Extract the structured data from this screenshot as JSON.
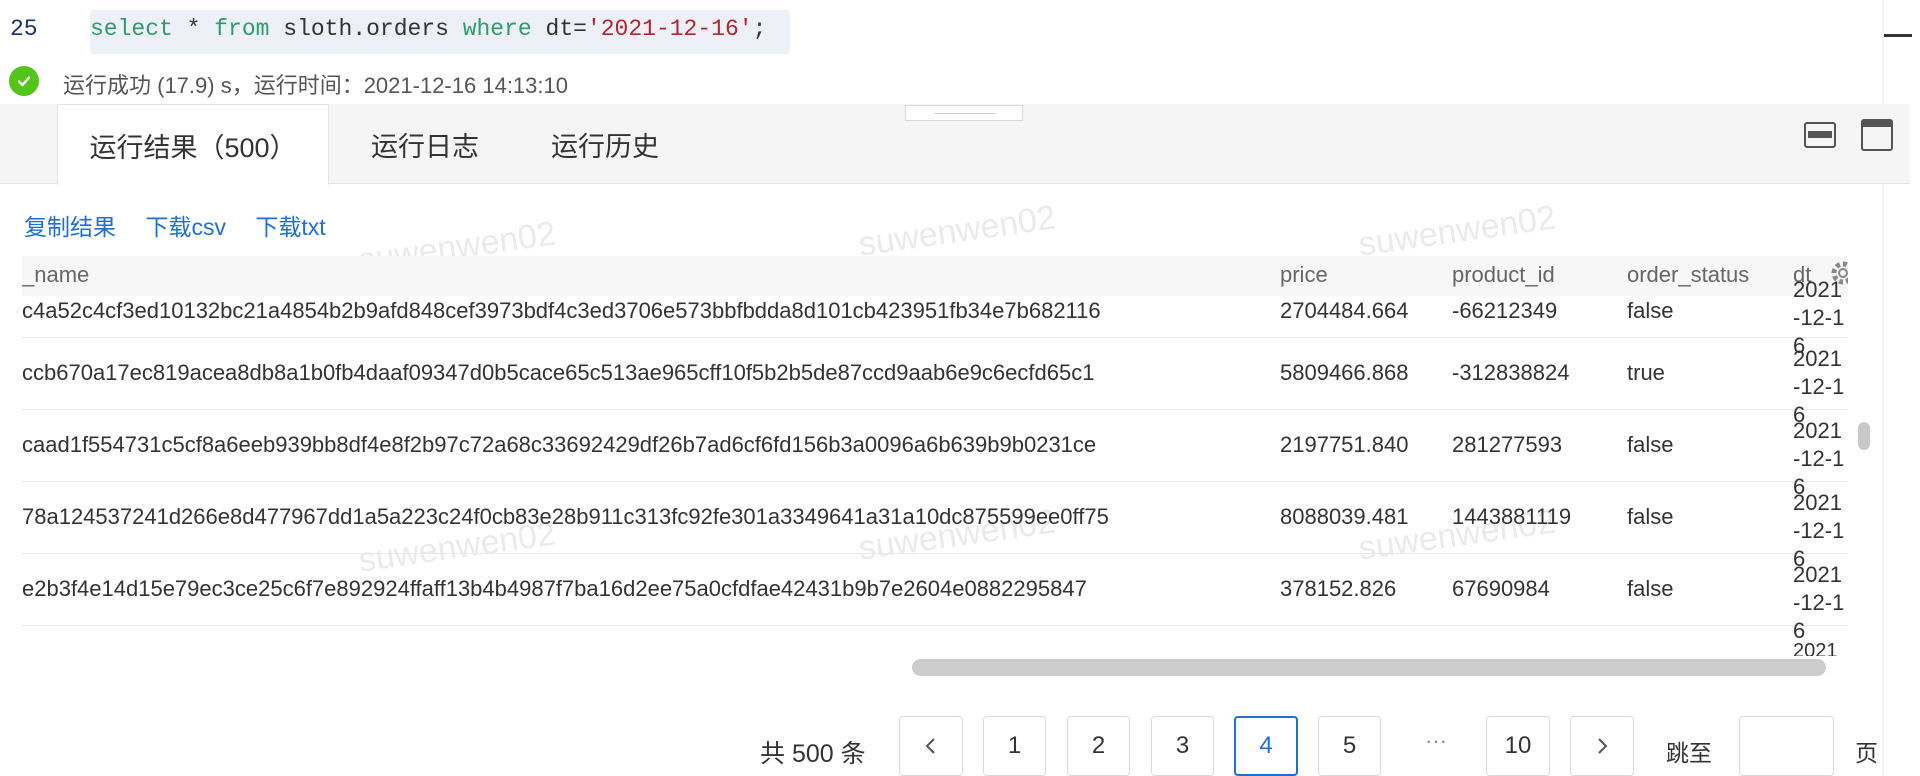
{
  "editor": {
    "line_number": "25",
    "code": {
      "kw_select": "select",
      "star": " * ",
      "kw_from": "from",
      "table": " sloth.orders ",
      "kw_where": "where",
      "cond": " dt=",
      "value": "'2021-12-16'",
      "terminator": ";"
    }
  },
  "status": {
    "icon": "check-circle-icon",
    "text": "运行成功 (17.9) s，运行时间：2021-12-16 14:13:10"
  },
  "tabs": [
    {
      "label": "运行结果（500）",
      "active": true
    },
    {
      "label": "运行日志",
      "active": false
    },
    {
      "label": "运行历史",
      "active": false
    }
  ],
  "panel_icons": [
    "minimize-panel-icon",
    "maximize-panel-icon"
  ],
  "actions": {
    "copy": "复制结果",
    "csv": "下载csv",
    "txt": "下载txt"
  },
  "watermark": "suwenwen02",
  "table": {
    "columns": [
      "_name",
      "price",
      "product_id",
      "order_status",
      "dt"
    ],
    "rows": [
      {
        "name": "c4a52c4cf3ed10132bc21a4854b2b9afd848cef3973bdf4c3ed3706e573bbfbdda8d101cb423951fb34e7b682116",
        "price": "2704484.664",
        "product_id": "-66212349",
        "order_status": "false",
        "dt": "2021-12-16"
      },
      {
        "name": "ccb670a17ec819acea8db8a1b0fb4daaf09347d0b5cace65c513ae965cff10f5b2b5de87ccd9aab6e9c6ecfd65c1",
        "price": "5809466.868",
        "product_id": "-312838824",
        "order_status": "true",
        "dt": "2021-12-16"
      },
      {
        "name": "caad1f554731c5cf8a6eeb939bb8df4e8f2b97c72a68c33692429df26b7ad6cf6fd156b3a0096a6b639b9b0231ce",
        "price": "2197751.840",
        "product_id": "281277593",
        "order_status": "false",
        "dt": "2021-12-16"
      },
      {
        "name": "78a124537241d266e8d477967dd1a5a223c24f0cb83e28b911c313fc92fe301a3349641a31a10dc875599ee0ff75",
        "price": "8088039.481",
        "product_id": "1443881119",
        "order_status": "false",
        "dt": "2021-12-16"
      },
      {
        "name": "e2b3f4e14d15e79ec3ce25c6f7e892924ffaff13b4b4987f7ba16d2ee75a0cfdfae42431b9b7e2604e0882295847",
        "price": "378152.826",
        "product_id": "67690984",
        "order_status": "false",
        "dt": "2021-12-16"
      }
    ],
    "partial_next_row_dt": "2021"
  },
  "pagination": {
    "total": "共 500 条",
    "prev_icon": "chevron-left-icon",
    "next_icon": "chevron-right-icon",
    "pages": [
      "1",
      "2",
      "3",
      "4",
      "5"
    ],
    "current": "4",
    "ellipsis": "···",
    "last": "10",
    "jump_label": "跳至",
    "jump_value": "",
    "unit": "页"
  }
}
